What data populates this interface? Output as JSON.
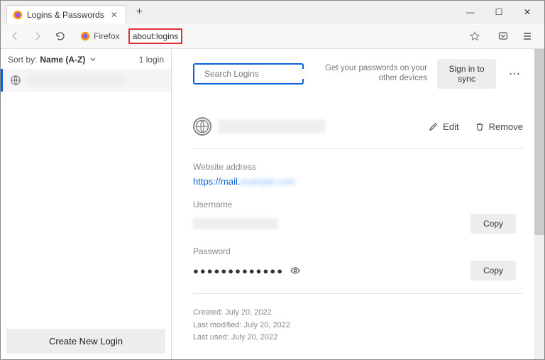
{
  "tab": {
    "title": "Logins & Passwords"
  },
  "url": {
    "identity": "Firefox",
    "address": "about:logins"
  },
  "sidebar": {
    "sort_label": "Sort by:",
    "sort_value": "Name (A-Z)",
    "count": "1 login",
    "create_btn": "Create New Login"
  },
  "search": {
    "placeholder": "Search Logins"
  },
  "sync": {
    "hint": "Get your passwords on your other devices",
    "signin": "Sign in to sync"
  },
  "detail": {
    "edit": "Edit",
    "remove": "Remove",
    "website_label": "Website address",
    "website_prefix": "https://mail.",
    "username_label": "Username",
    "password_label": "Password",
    "password_dots": "●●●●●●●●●●●●●",
    "copy": "Copy",
    "created_label": "Created:",
    "modified_label": "Last modified:",
    "used_label": "Last used:",
    "date": "July 20, 2022"
  }
}
